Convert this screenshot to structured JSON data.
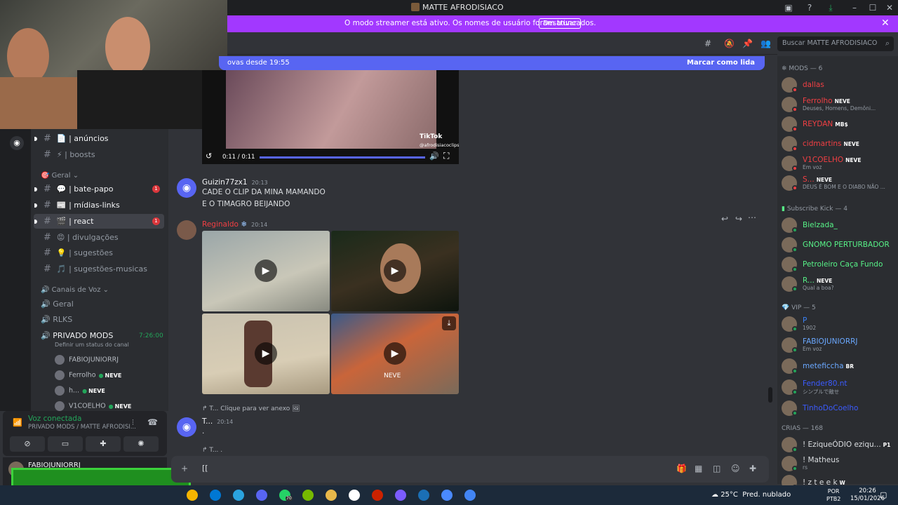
{
  "window": {
    "title": "MATTE AFRODISIACO"
  },
  "banner": {
    "text": "O modo streamer está ativo. Os nomes de usuário foram truncados.",
    "button": "Desativar"
  },
  "header": {
    "search_placeholder": "Buscar MATTE AFRODISIACO"
  },
  "new_messages": {
    "left": "ovas desde 19:55",
    "right": "Marcar como lida"
  },
  "channels": [
    {
      "emoji": "📄",
      "label": "| anúncios",
      "bright": true
    },
    {
      "emoji": "⚡",
      "label": "| boosts",
      "bright": false
    },
    {
      "emoji": "💬",
      "label": "| bate-papo",
      "bright": true,
      "badge": "1"
    },
    {
      "emoji": "📰",
      "label": "| mídias-links",
      "bright": true
    },
    {
      "emoji": "🎬",
      "label": "| react",
      "bright": true,
      "badge": "1",
      "active": true
    },
    {
      "emoji": "😡",
      "label": "| divulgações",
      "bright": false
    },
    {
      "emoji": "💡",
      "label": "| sugestões",
      "bright": false
    },
    {
      "emoji": "🎵",
      "label": "| sugestões-musicas",
      "bright": false
    }
  ],
  "categories": {
    "geral": "Geral",
    "voz": "Canais de Voz"
  },
  "voice_channels": {
    "geral": "Geral",
    "rlks": "RLKS",
    "privado": "PRIVADO MODS",
    "privado_time": "7:26:00",
    "privado_status": "Definir um status do canal"
  },
  "voice_users": [
    {
      "name": "FABIOJUNIORRJ",
      "tag": ""
    },
    {
      "name": "Ferrolho",
      "tag": "NEVE"
    },
    {
      "name": "h...",
      "tag": "NEVE"
    },
    {
      "name": "V1COELHO",
      "tag": "NEVE"
    }
  ],
  "voice_panel": {
    "status": "Voz conectada",
    "location": "PRIVADO MODS / MATTE AFRODISI..."
  },
  "user_panel": {
    "name": "FABIOJUNIORRJ"
  },
  "video": {
    "time": "0:11 / 0:11",
    "watermark": "TikTok",
    "handle": "@afrodisiacoclips"
  },
  "messages": [
    {
      "author": "Guizin77zx1",
      "time": "20:13",
      "lines": [
        "CADE O CLIP DA MINA MAMANDO",
        "E O TIMAGRO BEIJANDO"
      ]
    },
    {
      "author": "Reginaldo",
      "time": "20:14",
      "watermark": "NEVE"
    },
    {
      "reply": "T... Clique para ver anexo",
      "author": "T...",
      "time": "20:14",
      "lines": [
        "."
      ]
    },
    {
      "reply": "T... ."
    }
  ],
  "composer": {
    "value": "[["
  },
  "members": {
    "mods_title": "MODS — 6",
    "mods": [
      {
        "name": "dallas",
        "color": "#f23f43",
        "sub": ""
      },
      {
        "name": "Ferrolho",
        "color": "#f23f43",
        "tag": "NEVE",
        "sub": "Deuses, Homens, Demôni..."
      },
      {
        "name": "REYDAN",
        "color": "#f23f43",
        "tag": "MB$",
        "sub": ""
      },
      {
        "name": "cidmartins",
        "color": "#f23f43",
        "tag": "NEVE",
        "sub": ""
      },
      {
        "name": "V1COELHO",
        "color": "#f23f43",
        "tag": "NEVE",
        "sub": "Em voz"
      },
      {
        "name": "S...",
        "color": "#f23f43",
        "tag": "NEVE",
        "sub": "DEUS É BOM E O DIABO NÃO ..."
      }
    ],
    "kick_title": "Subscribe Kick — 4",
    "kick": [
      {
        "name": "Bielzada_",
        "color": "#57f287",
        "sub": ""
      },
      {
        "name": "GNOMO PERTURBADOR",
        "color": "#57f287",
        "sub": ""
      },
      {
        "name": "Petroleiro Caça Fundo",
        "color": "#57f287",
        "sub": ""
      },
      {
        "name": "R...",
        "color": "#57f287",
        "tag": "NEVE",
        "sub": "Qual a boa?"
      }
    ],
    "vip_title": "VIP — 5",
    "vip": [
      {
        "name": "P",
        "color": "#3b82f6",
        "sub": "1902"
      },
      {
        "name": "FABIOJUNIORRJ",
        "color": "#6aa8ff",
        "sub": "Em voz"
      },
      {
        "name": "meteficcha",
        "color": "#6aa8ff",
        "tag": "BR",
        "sub": ""
      },
      {
        "name": "Fender80.nt",
        "color": "#3b5bff",
        "sub": "シンプルで敵せ"
      },
      {
        "name": "TinhoDoCoelho",
        "color": "#3b5bff",
        "sub": ""
      }
    ],
    "crias_title": "CRIAS — 168",
    "crias": [
      {
        "name": "! EziqueÓDIO eziqu...",
        "color": "#dbdee1",
        "tag": "P1",
        "sub": ""
      },
      {
        "name": "! Matheus",
        "color": "#dbdee1",
        "sub": "rs"
      },
      {
        "name": "! z t e e k",
        "color": "#dbdee1",
        "tag": "W",
        "sub": ""
      }
    ]
  },
  "taskbar": {
    "temp": "25°C",
    "weather": "Pred. nublado",
    "lang1": "POR",
    "lang2": "PTB2",
    "time": "20:26",
    "date": "15/01/2026",
    "whatsapp_badge": "70"
  }
}
